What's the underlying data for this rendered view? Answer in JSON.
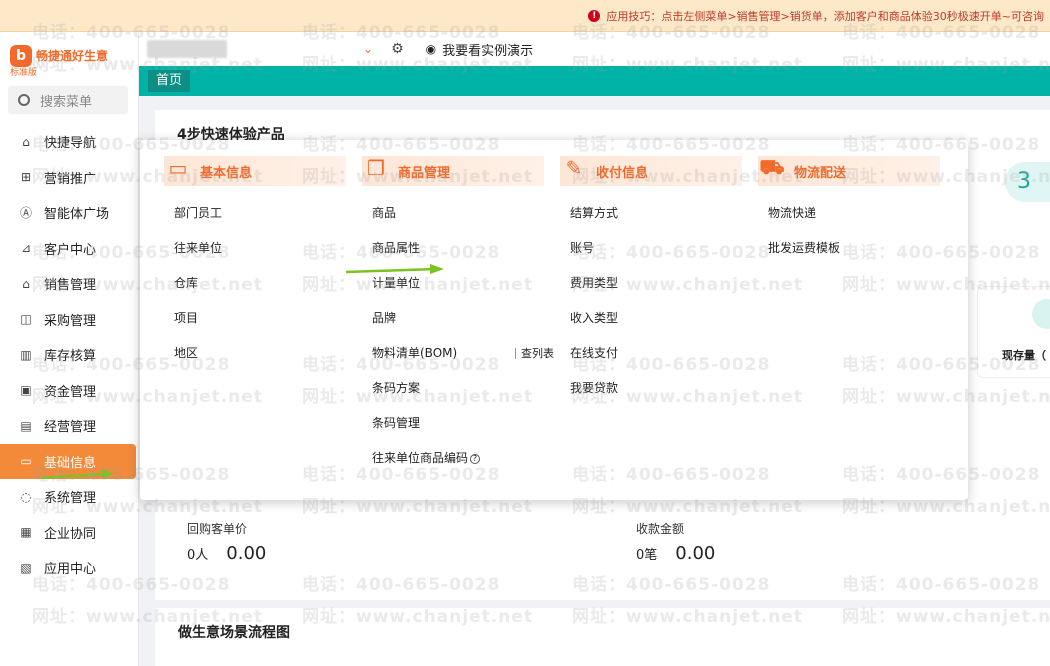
{
  "notice": {
    "text": "应用技巧：点击左侧菜单>销售管理>销货单，添加客户和商品体验30秒极速开单~可咨询"
  },
  "logo": {
    "text": "畅捷通好生意",
    "edition": "标准版",
    "mark": "b"
  },
  "sidebar": {
    "search_placeholder": "搜索菜单",
    "items": [
      {
        "label": "快捷导航",
        "icon": "home-icon"
      },
      {
        "label": "营销推广",
        "icon": "gift-icon"
      },
      {
        "label": "智能体广场",
        "icon": "ai-icon"
      },
      {
        "label": "客户中心",
        "icon": "chart-icon"
      },
      {
        "label": "销售管理",
        "icon": "store-icon"
      },
      {
        "label": "采购管理",
        "icon": "bag-icon"
      },
      {
        "label": "库存核算",
        "icon": "warehouse-icon"
      },
      {
        "label": "资金管理",
        "icon": "wallet-icon"
      },
      {
        "label": "经营管理",
        "icon": "clipboard-icon"
      },
      {
        "label": "基础信息",
        "icon": "id-card-icon"
      },
      {
        "label": "系统管理",
        "icon": "settings-icon"
      },
      {
        "label": "企业协同",
        "icon": "document-icon"
      },
      {
        "label": "应用中心",
        "icon": "calendar-icon"
      }
    ],
    "active_index": 9
  },
  "header": {
    "demo_label": "我要看实例演示"
  },
  "tabs": {
    "home": "首页"
  },
  "main": {
    "section_title": "4步快速体验产品",
    "step_number": "3",
    "right_panel_label": "现存量（",
    "stats": [
      {
        "label": "回购客单价",
        "unit": "0人",
        "amount": "0.00"
      },
      {
        "label": "收款金额",
        "unit": "0笔",
        "amount": "0.00"
      }
    ],
    "scene_title": "做生意场景流程图"
  },
  "popup": {
    "columns": [
      {
        "title": "基本信息",
        "icon": "id-card-icon",
        "items": [
          "部门员工",
          "往来单位",
          "仓库",
          "项目",
          "地区"
        ]
      },
      {
        "title": "商品管理",
        "icon": "box-icon",
        "items": [
          "商品",
          "商品属性",
          "计量单位",
          "品牌",
          "物料清单(BOM)",
          "条码方案",
          "条码管理",
          "往来单位商品编码"
        ],
        "extra_link": "查列表"
      },
      {
        "title": "收付信息",
        "icon": "pay-icon",
        "items": [
          "结算方式",
          "账号",
          "费用类型",
          "收入类型",
          "在线支付",
          "我要贷款"
        ]
      },
      {
        "title": "物流配送",
        "icon": "truck-icon",
        "items": [
          "物流快递",
          "批发运费模板"
        ]
      }
    ]
  },
  "watermark": {
    "phone": "电话：400-665-0028",
    "site": "网址：www.chanjet.net"
  },
  "colors": {
    "accent": "#f26a2b",
    "teal": "#00b3a6",
    "active_nav": "#f28a3a",
    "arrow": "#7cc321"
  }
}
